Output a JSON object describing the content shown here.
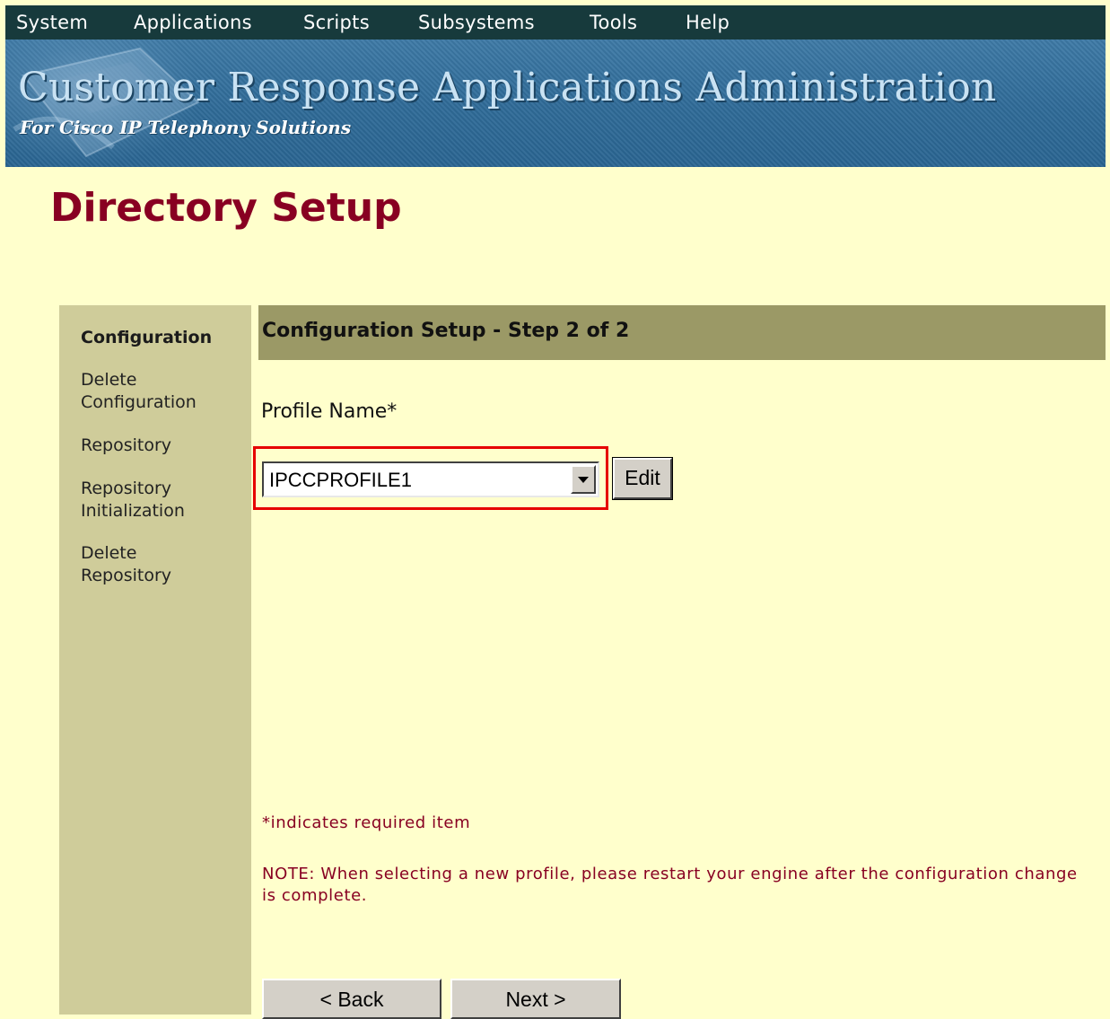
{
  "menu": {
    "items": [
      {
        "label": "System"
      },
      {
        "label": "Applications"
      },
      {
        "label": "Scripts"
      },
      {
        "label": "Subsystems"
      },
      {
        "label": "Tools"
      },
      {
        "label": "Help"
      }
    ]
  },
  "banner": {
    "title": "Customer Response Applications Administration",
    "subtitle": "For Cisco IP Telephony Solutions"
  },
  "page": {
    "title": "Directory Setup"
  },
  "sidebar": {
    "items": [
      {
        "label": "Configuration"
      },
      {
        "label": "Delete Configuration"
      },
      {
        "label": "Repository"
      },
      {
        "label": "Repository Initialization"
      },
      {
        "label": "Delete Repository"
      }
    ]
  },
  "step": {
    "header": "Configuration Setup - Step 2 of 2"
  },
  "form": {
    "profile_label": "Profile Name*",
    "profile_value": "IPCCPROFILE1",
    "edit_label": "Edit",
    "required_note": "*indicates required item",
    "restart_note": "NOTE: When selecting a new profile, please restart your engine after the configuration change is complete.",
    "back_label": "< Back",
    "next_label": "Next >"
  },
  "colors": {
    "page_bg": "#ffffcc",
    "menubar_bg": "#173a3c",
    "banner_bg": "#2f6b98",
    "title_red": "#880022",
    "sidebar_bg": "#cfcc9a",
    "step_header_bg": "#9b9966",
    "highlight": "#e60000"
  }
}
